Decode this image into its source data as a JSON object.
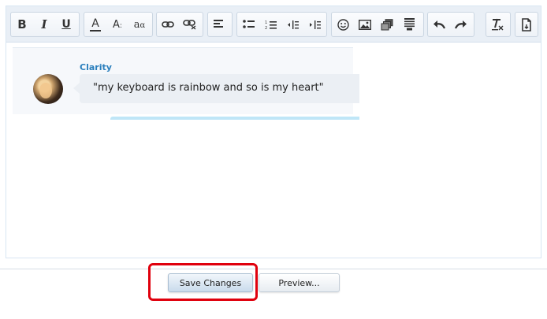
{
  "toolbar": {
    "groups": [
      {
        "name": "text-style",
        "buttons": [
          {
            "icon": "bold-icon",
            "label": "B"
          },
          {
            "icon": "italic-icon",
            "label": "I"
          },
          {
            "icon": "underline-icon",
            "label": "U"
          }
        ]
      },
      {
        "name": "font",
        "buttons": [
          {
            "icon": "text-color-icon",
            "label": "A"
          },
          {
            "icon": "font-size-icon",
            "label": "A"
          },
          {
            "icon": "font-family-icon",
            "label": "a"
          }
        ]
      },
      {
        "name": "links",
        "buttons": [
          {
            "icon": "link-icon"
          },
          {
            "icon": "unlink-icon"
          }
        ]
      },
      {
        "name": "alignment",
        "buttons": [
          {
            "icon": "align-left-icon"
          }
        ]
      },
      {
        "name": "lists",
        "buttons": [
          {
            "icon": "bulleted-list-icon"
          },
          {
            "icon": "numbered-list-icon"
          },
          {
            "icon": "outdent-icon"
          },
          {
            "icon": "indent-icon"
          }
        ]
      },
      {
        "name": "insert",
        "buttons": [
          {
            "icon": "smiley-icon"
          },
          {
            "icon": "image-icon"
          },
          {
            "icon": "media-icon"
          },
          {
            "icon": "code-block-icon"
          }
        ]
      },
      {
        "name": "history",
        "buttons": [
          {
            "icon": "undo-icon"
          },
          {
            "icon": "redo-icon"
          }
        ]
      },
      {
        "name": "format",
        "buttons": [
          {
            "icon": "remove-formatting-icon"
          }
        ]
      },
      {
        "name": "options",
        "buttons": [
          {
            "icon": "toggle-bbcode-icon"
          }
        ]
      }
    ]
  },
  "message": {
    "username": "Clarity",
    "text": "\"my keyboard is rainbow and so is my heart\"",
    "avatar_icon": "user-avatar-icon"
  },
  "actions": {
    "save_label": "Save Changes",
    "preview_label": "Preview..."
  },
  "colors": {
    "accent": "#2a7fbd",
    "highlight": "#e0000d",
    "quote_line": "#bfe6f7"
  }
}
